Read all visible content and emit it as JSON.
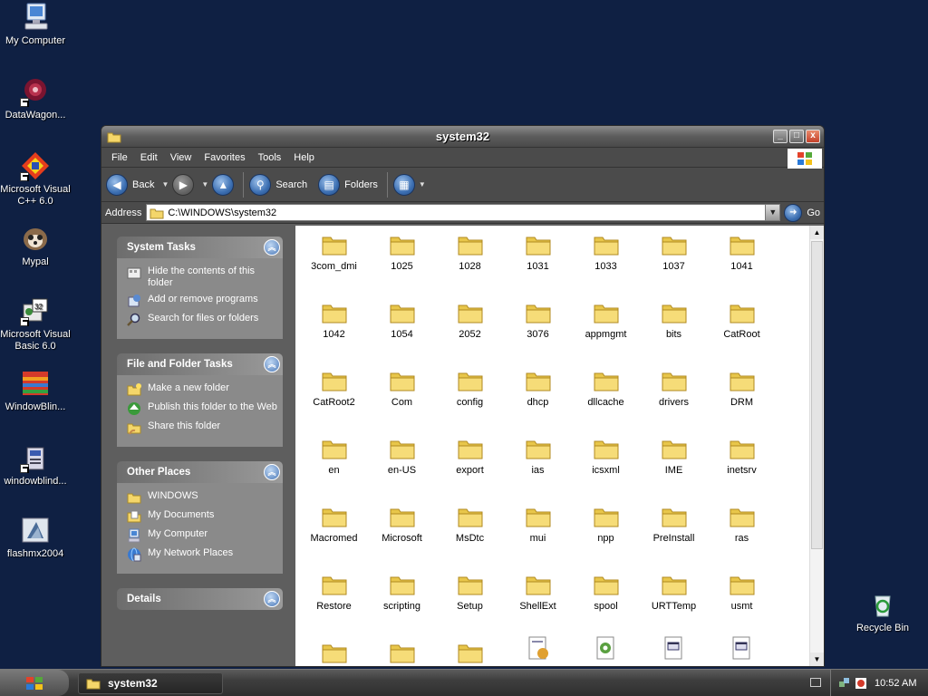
{
  "desktop": {
    "icons": [
      {
        "label": "My Computer",
        "icon": "computer-icon"
      },
      {
        "label": "DataWagon...",
        "icon": "datawagon-icon"
      },
      {
        "label": "Microsoft Visual C++ 6.0",
        "icon": "visual-cpp-icon"
      },
      {
        "label": "Mypal",
        "icon": "mypal-icon"
      },
      {
        "label": "Microsoft Visual Basic 6.0",
        "icon": "visual-basic-icon"
      },
      {
        "label": "WindowBlin...",
        "icon": "windowblinds-icon"
      },
      {
        "label": "windowblind...",
        "icon": "installer-icon"
      },
      {
        "label": "flashmx2004",
        "icon": "flash-icon"
      },
      {
        "label": "Recycle Bin",
        "icon": "recycle-bin-icon"
      }
    ]
  },
  "window": {
    "title": "system32",
    "controls": {
      "minimize": "_",
      "maximize": "□",
      "close": "x"
    }
  },
  "menu": [
    "File",
    "Edit",
    "View",
    "Favorites",
    "Tools",
    "Help"
  ],
  "toolbar": {
    "back": "Back",
    "search": "Search",
    "folders": "Folders"
  },
  "address": {
    "label": "Address",
    "value": "C:\\WINDOWS\\system32",
    "go": "Go"
  },
  "taskpane": {
    "system_tasks": {
      "title": "System Tasks",
      "items": [
        "Hide the contents of this folder",
        "Add or remove programs",
        "Search for files or folders"
      ]
    },
    "file_tasks": {
      "title": "File and Folder Tasks",
      "items": [
        "Make a new folder",
        "Publish this folder to the Web",
        "Share this folder"
      ]
    },
    "other_places": {
      "title": "Other Places",
      "items": [
        "WINDOWS",
        "My Documents",
        "My Computer",
        "My Network Places"
      ]
    },
    "details": {
      "title": "Details"
    }
  },
  "files": [
    "3com_dmi",
    "1025",
    "1028",
    "1031",
    "1033",
    "1037",
    "1041",
    "1042",
    "1054",
    "2052",
    "3076",
    "appmgmt",
    "bits",
    "CatRoot",
    "CatRoot2",
    "Com",
    "config",
    "dhcp",
    "dllcache",
    "drivers",
    "DRM",
    "en",
    "en-US",
    "export",
    "ias",
    "icsxml",
    "IME",
    "inetsrv",
    "Macromed",
    "Microsoft",
    "MsDtc",
    "mui",
    "npp",
    "PreInstall",
    "ras",
    "Restore",
    "scripting",
    "Setup",
    "ShellExt",
    "spool",
    "URTTemp",
    "usmt"
  ],
  "partial_row": [
    "folder",
    "folder",
    "folder",
    "settings-file",
    "gear-file",
    "window-file",
    "window-file"
  ],
  "taskbar": {
    "app": "system32",
    "clock": "10:52 AM"
  }
}
